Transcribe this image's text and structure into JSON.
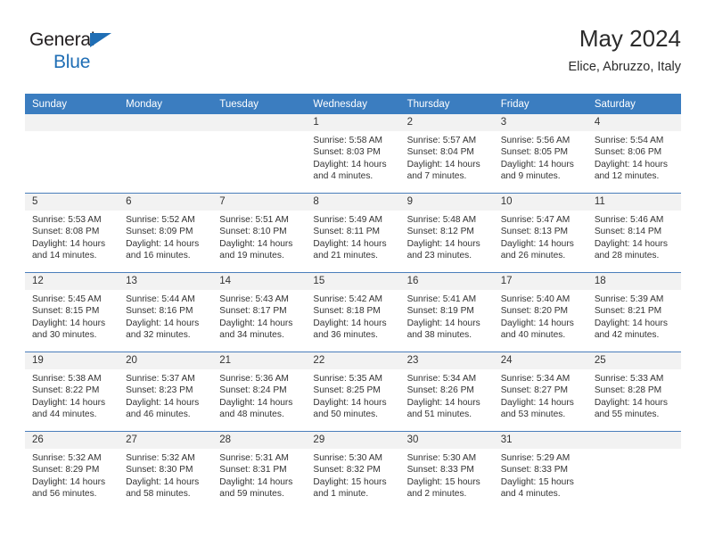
{
  "brand": {
    "name_part1": "General",
    "name_part2": "Blue",
    "accent_color": "#1f6eb5"
  },
  "header": {
    "title": "May 2024",
    "subtitle": "Elice, Abruzzo, Italy"
  },
  "theme": {
    "header_bar_color": "#3b7dc0",
    "daynum_band_color": "#f2f2f2",
    "week_separator_color": "#4a7ebb",
    "text_color": "#333333"
  },
  "calendar": {
    "weekday_headers": [
      "Sunday",
      "Monday",
      "Tuesday",
      "Wednesday",
      "Thursday",
      "Friday",
      "Saturday"
    ],
    "weeks": [
      [
        {
          "day": "",
          "empty": true
        },
        {
          "day": "",
          "empty": true
        },
        {
          "day": "",
          "empty": true
        },
        {
          "day": "1",
          "sunrise": "Sunrise: 5:58 AM",
          "sunset": "Sunset: 8:03 PM",
          "daylight1": "Daylight: 14 hours",
          "daylight2": "and 4 minutes."
        },
        {
          "day": "2",
          "sunrise": "Sunrise: 5:57 AM",
          "sunset": "Sunset: 8:04 PM",
          "daylight1": "Daylight: 14 hours",
          "daylight2": "and 7 minutes."
        },
        {
          "day": "3",
          "sunrise": "Sunrise: 5:56 AM",
          "sunset": "Sunset: 8:05 PM",
          "daylight1": "Daylight: 14 hours",
          "daylight2": "and 9 minutes."
        },
        {
          "day": "4",
          "sunrise": "Sunrise: 5:54 AM",
          "sunset": "Sunset: 8:06 PM",
          "daylight1": "Daylight: 14 hours",
          "daylight2": "and 12 minutes."
        }
      ],
      [
        {
          "day": "5",
          "sunrise": "Sunrise: 5:53 AM",
          "sunset": "Sunset: 8:08 PM",
          "daylight1": "Daylight: 14 hours",
          "daylight2": "and 14 minutes."
        },
        {
          "day": "6",
          "sunrise": "Sunrise: 5:52 AM",
          "sunset": "Sunset: 8:09 PM",
          "daylight1": "Daylight: 14 hours",
          "daylight2": "and 16 minutes."
        },
        {
          "day": "7",
          "sunrise": "Sunrise: 5:51 AM",
          "sunset": "Sunset: 8:10 PM",
          "daylight1": "Daylight: 14 hours",
          "daylight2": "and 19 minutes."
        },
        {
          "day": "8",
          "sunrise": "Sunrise: 5:49 AM",
          "sunset": "Sunset: 8:11 PM",
          "daylight1": "Daylight: 14 hours",
          "daylight2": "and 21 minutes."
        },
        {
          "day": "9",
          "sunrise": "Sunrise: 5:48 AM",
          "sunset": "Sunset: 8:12 PM",
          "daylight1": "Daylight: 14 hours",
          "daylight2": "and 23 minutes."
        },
        {
          "day": "10",
          "sunrise": "Sunrise: 5:47 AM",
          "sunset": "Sunset: 8:13 PM",
          "daylight1": "Daylight: 14 hours",
          "daylight2": "and 26 minutes."
        },
        {
          "day": "11",
          "sunrise": "Sunrise: 5:46 AM",
          "sunset": "Sunset: 8:14 PM",
          "daylight1": "Daylight: 14 hours",
          "daylight2": "and 28 minutes."
        }
      ],
      [
        {
          "day": "12",
          "sunrise": "Sunrise: 5:45 AM",
          "sunset": "Sunset: 8:15 PM",
          "daylight1": "Daylight: 14 hours",
          "daylight2": "and 30 minutes."
        },
        {
          "day": "13",
          "sunrise": "Sunrise: 5:44 AM",
          "sunset": "Sunset: 8:16 PM",
          "daylight1": "Daylight: 14 hours",
          "daylight2": "and 32 minutes."
        },
        {
          "day": "14",
          "sunrise": "Sunrise: 5:43 AM",
          "sunset": "Sunset: 8:17 PM",
          "daylight1": "Daylight: 14 hours",
          "daylight2": "and 34 minutes."
        },
        {
          "day": "15",
          "sunrise": "Sunrise: 5:42 AM",
          "sunset": "Sunset: 8:18 PM",
          "daylight1": "Daylight: 14 hours",
          "daylight2": "and 36 minutes."
        },
        {
          "day": "16",
          "sunrise": "Sunrise: 5:41 AM",
          "sunset": "Sunset: 8:19 PM",
          "daylight1": "Daylight: 14 hours",
          "daylight2": "and 38 minutes."
        },
        {
          "day": "17",
          "sunrise": "Sunrise: 5:40 AM",
          "sunset": "Sunset: 8:20 PM",
          "daylight1": "Daylight: 14 hours",
          "daylight2": "and 40 minutes."
        },
        {
          "day": "18",
          "sunrise": "Sunrise: 5:39 AM",
          "sunset": "Sunset: 8:21 PM",
          "daylight1": "Daylight: 14 hours",
          "daylight2": "and 42 minutes."
        }
      ],
      [
        {
          "day": "19",
          "sunrise": "Sunrise: 5:38 AM",
          "sunset": "Sunset: 8:22 PM",
          "daylight1": "Daylight: 14 hours",
          "daylight2": "and 44 minutes."
        },
        {
          "day": "20",
          "sunrise": "Sunrise: 5:37 AM",
          "sunset": "Sunset: 8:23 PM",
          "daylight1": "Daylight: 14 hours",
          "daylight2": "and 46 minutes."
        },
        {
          "day": "21",
          "sunrise": "Sunrise: 5:36 AM",
          "sunset": "Sunset: 8:24 PM",
          "daylight1": "Daylight: 14 hours",
          "daylight2": "and 48 minutes."
        },
        {
          "day": "22",
          "sunrise": "Sunrise: 5:35 AM",
          "sunset": "Sunset: 8:25 PM",
          "daylight1": "Daylight: 14 hours",
          "daylight2": "and 50 minutes."
        },
        {
          "day": "23",
          "sunrise": "Sunrise: 5:34 AM",
          "sunset": "Sunset: 8:26 PM",
          "daylight1": "Daylight: 14 hours",
          "daylight2": "and 51 minutes."
        },
        {
          "day": "24",
          "sunrise": "Sunrise: 5:34 AM",
          "sunset": "Sunset: 8:27 PM",
          "daylight1": "Daylight: 14 hours",
          "daylight2": "and 53 minutes."
        },
        {
          "day": "25",
          "sunrise": "Sunrise: 5:33 AM",
          "sunset": "Sunset: 8:28 PM",
          "daylight1": "Daylight: 14 hours",
          "daylight2": "and 55 minutes."
        }
      ],
      [
        {
          "day": "26",
          "sunrise": "Sunrise: 5:32 AM",
          "sunset": "Sunset: 8:29 PM",
          "daylight1": "Daylight: 14 hours",
          "daylight2": "and 56 minutes."
        },
        {
          "day": "27",
          "sunrise": "Sunrise: 5:32 AM",
          "sunset": "Sunset: 8:30 PM",
          "daylight1": "Daylight: 14 hours",
          "daylight2": "and 58 minutes."
        },
        {
          "day": "28",
          "sunrise": "Sunrise: 5:31 AM",
          "sunset": "Sunset: 8:31 PM",
          "daylight1": "Daylight: 14 hours",
          "daylight2": "and 59 minutes."
        },
        {
          "day": "29",
          "sunrise": "Sunrise: 5:30 AM",
          "sunset": "Sunset: 8:32 PM",
          "daylight1": "Daylight: 15 hours",
          "daylight2": "and 1 minute."
        },
        {
          "day": "30",
          "sunrise": "Sunrise: 5:30 AM",
          "sunset": "Sunset: 8:33 PM",
          "daylight1": "Daylight: 15 hours",
          "daylight2": "and 2 minutes."
        },
        {
          "day": "31",
          "sunrise": "Sunrise: 5:29 AM",
          "sunset": "Sunset: 8:33 PM",
          "daylight1": "Daylight: 15 hours",
          "daylight2": "and 4 minutes."
        },
        {
          "day": "",
          "empty": true
        }
      ]
    ]
  }
}
